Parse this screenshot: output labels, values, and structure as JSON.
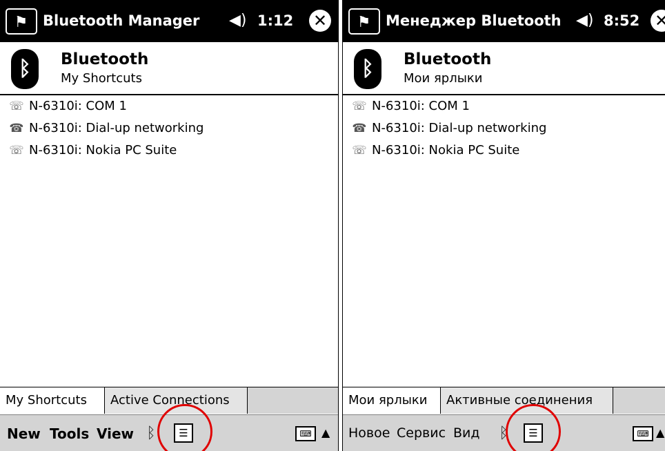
{
  "screens": {
    "en": {
      "app_title": "Bluetooth Manager",
      "clock": "1:12",
      "header": {
        "title": "Bluetooth",
        "subtitle": "My Shortcuts"
      },
      "items": [
        {
          "label": "N-6310i: COM 1",
          "icon": "serial-port-phone-icon"
        },
        {
          "label": "N-6310i: Dial-up networking",
          "icon": "dialup-phone-icon"
        },
        {
          "label": "N-6310i: Nokia PC Suite",
          "icon": "serial-port-phone-icon"
        }
      ],
      "tabs": [
        {
          "label": "My Shortcuts",
          "active": true
        },
        {
          "label": "Active Connections",
          "active": false
        }
      ],
      "menu": {
        "new": "New",
        "tools": "Tools",
        "view": "View"
      }
    },
    "ru": {
      "app_title": "Менеджер Bluetooth",
      "clock": "8:52",
      "header": {
        "title": "Bluetooth",
        "subtitle": "Мои ярлыки"
      },
      "items": [
        {
          "label": "N-6310i: COM 1",
          "icon": "serial-port-phone-icon"
        },
        {
          "label": "N-6310i: Dial-up networking",
          "icon": "dialup-phone-icon"
        },
        {
          "label": "N-6310i: Nokia PC Suite",
          "icon": "serial-port-phone-icon"
        }
      ],
      "tabs": [
        {
          "label": "Мои ярлыки",
          "active": true
        },
        {
          "label": "Активные соединения",
          "active": false
        }
      ],
      "menu": {
        "new": "Новое",
        "tools": "Сервис",
        "view": "Вид"
      }
    }
  },
  "icons": {
    "start": "windows-flag-icon",
    "volume": "speaker-icon",
    "close": "close-icon",
    "app": "bluetooth-icon",
    "tray_bluetooth": "bluetooth-tray-icon",
    "tray_contact": "contact-card-icon",
    "keyboard": "keyboard-icon",
    "sip": "up-arrow-icon"
  },
  "colors": {
    "titlebar_bg": "#000000",
    "highlight_circle": "#e00000",
    "menubar_bg": "#d4d4d4"
  }
}
